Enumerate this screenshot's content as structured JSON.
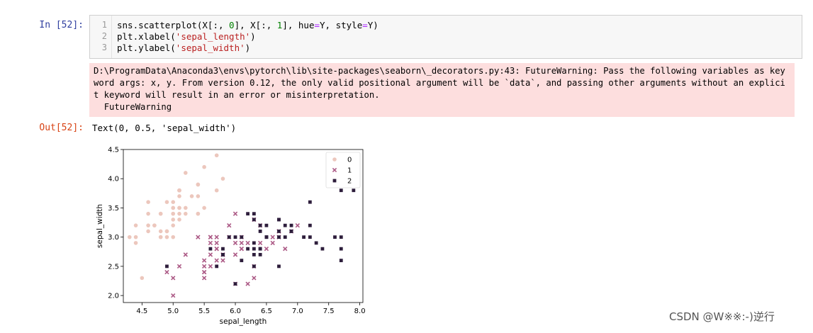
{
  "input_cell": {
    "prompt": "In [52]:",
    "line_numbers": [
      "1",
      "2",
      "3"
    ],
    "lines": [
      [
        {
          "t": "sns.scatterplot(X[:, ",
          "c": ""
        },
        {
          "t": "0",
          "c": "num"
        },
        {
          "t": "], X[:, ",
          "c": ""
        },
        {
          "t": "1",
          "c": "num"
        },
        {
          "t": "], hue",
          "c": ""
        },
        {
          "t": "=",
          "c": "eq"
        },
        {
          "t": "Y, style",
          "c": ""
        },
        {
          "t": "=",
          "c": "eq"
        },
        {
          "t": "Y)",
          "c": ""
        }
      ],
      [
        {
          "t": "plt.xlabel(",
          "c": ""
        },
        {
          "t": "'sepal_length'",
          "c": "str"
        },
        {
          "t": ")",
          "c": ""
        }
      ],
      [
        {
          "t": "plt.ylabel(",
          "c": ""
        },
        {
          "t": "'sepal_width'",
          "c": "str"
        },
        {
          "t": ")",
          "c": ""
        }
      ]
    ]
  },
  "stderr": "D:\\ProgramData\\Anaconda3\\envs\\pytorch\\lib\\site-packages\\seaborn\\_decorators.py:43: FutureWarning: Pass the following variables as keyword args: x, y. From version 0.12, the only valid positional argument will be `data`, and passing other arguments without an explicit keyword will result in an error or misinterpretation.\n  FutureWarning",
  "output_cell": {
    "prompt": "Out[52]:",
    "text": "Text(0, 0.5, 'sepal_width')"
  },
  "colors": {
    "series0": "#ecc7bd",
    "series1": "#ac5a86",
    "series2": "#2e1e3c"
  },
  "chart_data": {
    "type": "scatter",
    "xlabel": "sepal_length",
    "ylabel": "sepal_width",
    "xlim": [
      4.2,
      8.05
    ],
    "ylim": [
      1.88,
      4.5
    ],
    "xticks": [
      4.5,
      5.0,
      5.5,
      6.0,
      6.5,
      7.0,
      7.5,
      8.0
    ],
    "xtick_labels": [
      "4.5",
      "5.0",
      "5.5",
      "6.0",
      "6.5",
      "7.0",
      "7.5",
      "8.0"
    ],
    "yticks": [
      2.0,
      2.5,
      3.0,
      3.5,
      4.0,
      4.5
    ],
    "ytick_labels": [
      "2.0",
      "2.5",
      "3.0",
      "3.5",
      "4.0",
      "4.5"
    ],
    "grid": false,
    "legend_position": "top-right",
    "series": [
      {
        "name": "0",
        "marker": "circle",
        "points": [
          [
            5.1,
            3.5
          ],
          [
            4.9,
            3.0
          ],
          [
            4.7,
            3.2
          ],
          [
            4.6,
            3.1
          ],
          [
            5.0,
            3.6
          ],
          [
            5.4,
            3.9
          ],
          [
            4.6,
            3.4
          ],
          [
            5.0,
            3.4
          ],
          [
            4.4,
            2.9
          ],
          [
            4.9,
            3.1
          ],
          [
            5.4,
            3.7
          ],
          [
            4.8,
            3.4
          ],
          [
            4.8,
            3.0
          ],
          [
            4.3,
            3.0
          ],
          [
            5.8,
            4.0
          ],
          [
            5.7,
            4.4
          ],
          [
            5.4,
            3.9
          ],
          [
            5.1,
            3.5
          ],
          [
            5.7,
            3.8
          ],
          [
            5.1,
            3.8
          ],
          [
            5.4,
            3.4
          ],
          [
            5.1,
            3.7
          ],
          [
            4.6,
            3.6
          ],
          [
            5.1,
            3.3
          ],
          [
            4.8,
            3.4
          ],
          [
            5.0,
            3.0
          ],
          [
            5.0,
            3.4
          ],
          [
            5.2,
            3.5
          ],
          [
            5.2,
            3.4
          ],
          [
            4.7,
            3.2
          ],
          [
            4.8,
            3.1
          ],
          [
            5.4,
            3.4
          ],
          [
            5.2,
            4.1
          ],
          [
            5.5,
            4.2
          ],
          [
            4.9,
            3.1
          ],
          [
            5.0,
            3.2
          ],
          [
            5.5,
            3.5
          ],
          [
            4.9,
            3.6
          ],
          [
            4.4,
            3.0
          ],
          [
            5.1,
            3.4
          ],
          [
            5.0,
            3.5
          ],
          [
            4.5,
            2.3
          ],
          [
            4.4,
            3.2
          ],
          [
            5.0,
            3.5
          ],
          [
            5.1,
            3.8
          ],
          [
            4.8,
            3.0
          ],
          [
            5.1,
            3.8
          ],
          [
            4.6,
            3.2
          ],
          [
            5.3,
            3.7
          ],
          [
            5.0,
            3.3
          ]
        ]
      },
      {
        "name": "1",
        "marker": "x",
        "points": [
          [
            7.0,
            3.2
          ],
          [
            6.4,
            3.2
          ],
          [
            6.9,
            3.1
          ],
          [
            5.5,
            2.3
          ],
          [
            6.5,
            2.8
          ],
          [
            5.7,
            2.8
          ],
          [
            6.3,
            3.3
          ],
          [
            4.9,
            2.4
          ],
          [
            6.6,
            2.9
          ],
          [
            5.2,
            2.7
          ],
          [
            5.0,
            2.0
          ],
          [
            5.9,
            3.0
          ],
          [
            6.0,
            2.2
          ],
          [
            6.1,
            2.9
          ],
          [
            5.6,
            2.9
          ],
          [
            6.7,
            3.1
          ],
          [
            5.6,
            3.0
          ],
          [
            5.8,
            2.7
          ],
          [
            6.2,
            2.2
          ],
          [
            5.6,
            2.5
          ],
          [
            5.9,
            3.2
          ],
          [
            6.1,
            2.8
          ],
          [
            6.3,
            2.5
          ],
          [
            6.1,
            2.8
          ],
          [
            6.4,
            2.9
          ],
          [
            6.6,
            3.0
          ],
          [
            6.8,
            2.8
          ],
          [
            6.7,
            3.0
          ],
          [
            6.0,
            2.9
          ],
          [
            5.7,
            2.6
          ],
          [
            5.5,
            2.4
          ],
          [
            5.5,
            2.4
          ],
          [
            5.8,
            2.7
          ],
          [
            6.0,
            2.7
          ],
          [
            5.4,
            3.0
          ],
          [
            6.0,
            3.4
          ],
          [
            6.7,
            3.1
          ],
          [
            6.3,
            2.3
          ],
          [
            5.6,
            3.0
          ],
          [
            5.5,
            2.5
          ],
          [
            5.5,
            2.6
          ],
          [
            6.1,
            3.0
          ],
          [
            5.8,
            2.6
          ],
          [
            5.0,
            2.3
          ],
          [
            5.6,
            2.7
          ],
          [
            5.7,
            3.0
          ],
          [
            5.7,
            2.9
          ],
          [
            6.2,
            2.9
          ],
          [
            5.1,
            2.5
          ],
          [
            5.7,
            2.8
          ]
        ]
      },
      {
        "name": "2",
        "marker": "square",
        "points": [
          [
            6.3,
            3.3
          ],
          [
            5.8,
            2.7
          ],
          [
            7.1,
            3.0
          ],
          [
            6.3,
            2.9
          ],
          [
            6.5,
            3.0
          ],
          [
            7.6,
            3.0
          ],
          [
            4.9,
            2.5
          ],
          [
            7.3,
            2.9
          ],
          [
            6.7,
            2.5
          ],
          [
            7.2,
            3.6
          ],
          [
            6.5,
            3.2
          ],
          [
            6.4,
            2.7
          ],
          [
            6.8,
            3.0
          ],
          [
            5.7,
            2.5
          ],
          [
            5.8,
            2.8
          ],
          [
            6.4,
            3.2
          ],
          [
            6.5,
            3.0
          ],
          [
            7.7,
            3.8
          ],
          [
            7.7,
            2.6
          ],
          [
            6.0,
            2.2
          ],
          [
            6.9,
            3.2
          ],
          [
            5.6,
            2.8
          ],
          [
            7.7,
            2.8
          ],
          [
            6.3,
            2.7
          ],
          [
            6.7,
            3.3
          ],
          [
            7.2,
            3.2
          ],
          [
            6.2,
            2.8
          ],
          [
            6.1,
            3.0
          ],
          [
            6.4,
            2.8
          ],
          [
            7.2,
            3.0
          ],
          [
            7.4,
            2.8
          ],
          [
            7.9,
            3.8
          ],
          [
            6.4,
            2.8
          ],
          [
            6.3,
            2.8
          ],
          [
            6.1,
            2.6
          ],
          [
            7.7,
            3.0
          ],
          [
            6.3,
            3.4
          ],
          [
            6.4,
            3.1
          ],
          [
            6.0,
            3.0
          ],
          [
            6.9,
            3.1
          ],
          [
            6.7,
            3.1
          ],
          [
            6.9,
            3.1
          ],
          [
            5.8,
            2.7
          ],
          [
            6.8,
            3.2
          ],
          [
            6.7,
            3.3
          ],
          [
            6.7,
            3.0
          ],
          [
            6.3,
            2.5
          ],
          [
            6.5,
            3.0
          ],
          [
            6.2,
            3.4
          ],
          [
            5.9,
            3.0
          ]
        ]
      }
    ]
  },
  "watermark": "CSDN @W※※:-)逆行"
}
